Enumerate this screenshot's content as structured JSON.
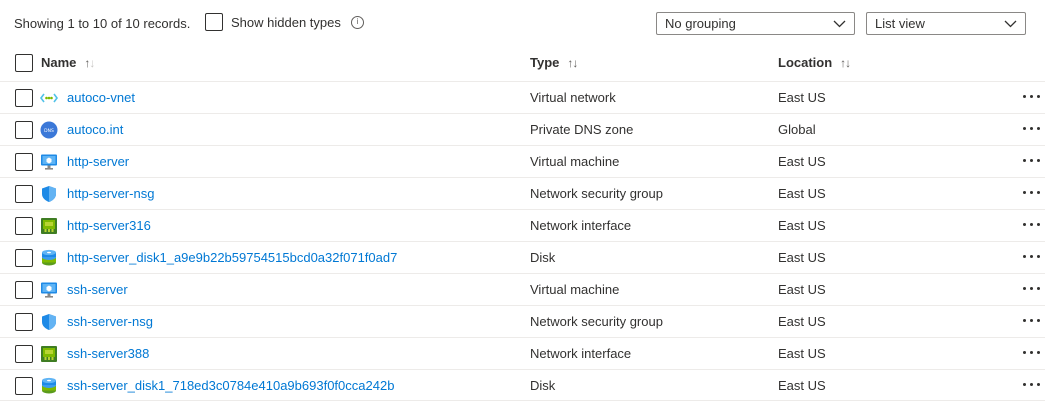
{
  "toolbar": {
    "records_text": "Showing 1 to 10 of 10 records.",
    "show_hidden_label": "Show hidden types",
    "grouping_value": "No grouping",
    "view_value": "List view"
  },
  "columns": {
    "name": "Name",
    "type": "Type",
    "location": "Location"
  },
  "rows": [
    {
      "name": "autoco-vnet",
      "type": "Virtual network",
      "location": "East US",
      "icon": "virtual-network-icon"
    },
    {
      "name": "autoco.int",
      "type": "Private DNS zone",
      "location": "Global",
      "icon": "dns-zone-icon"
    },
    {
      "name": "http-server",
      "type": "Virtual machine",
      "location": "East US",
      "icon": "virtual-machine-icon"
    },
    {
      "name": "http-server-nsg",
      "type": "Network security group",
      "location": "East US",
      "icon": "network-security-group-icon"
    },
    {
      "name": "http-server316",
      "type": "Network interface",
      "location": "East US",
      "icon": "network-interface-icon"
    },
    {
      "name": "http-server_disk1_a9e9b22b59754515bcd0a32f071f0ad7",
      "type": "Disk",
      "location": "East US",
      "icon": "disk-icon"
    },
    {
      "name": "ssh-server",
      "type": "Virtual machine",
      "location": "East US",
      "icon": "virtual-machine-icon"
    },
    {
      "name": "ssh-server-nsg",
      "type": "Network security group",
      "location": "East US",
      "icon": "network-security-group-icon"
    },
    {
      "name": "ssh-server388",
      "type": "Network interface",
      "location": "East US",
      "icon": "network-interface-icon"
    },
    {
      "name": "ssh-server_disk1_718ed3c0784e410a9b693f0f0cca242b",
      "type": "Disk",
      "location": "East US",
      "icon": "disk-icon"
    }
  ],
  "colors": {
    "link": "#0078d4",
    "text": "#323130",
    "border": "#edebe9"
  }
}
